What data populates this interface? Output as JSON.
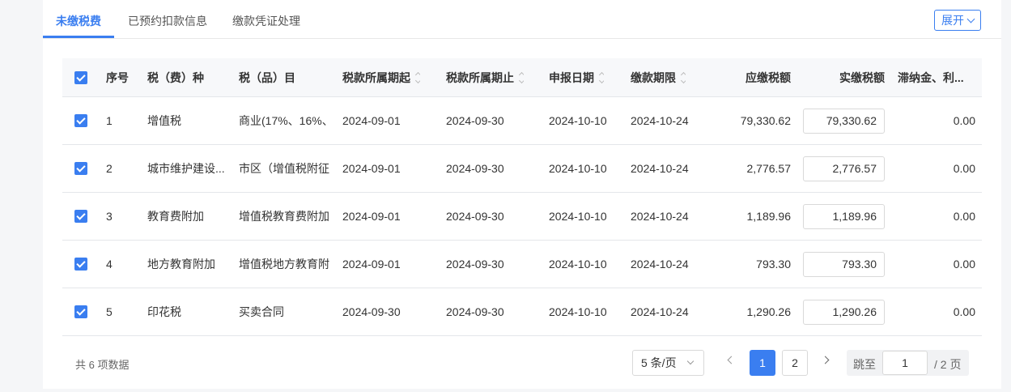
{
  "tabs": [
    {
      "label": "未缴税费",
      "active": true
    },
    {
      "label": "已预约扣款信息",
      "active": false
    },
    {
      "label": "缴款凭证处理",
      "active": false
    }
  ],
  "expand_label": "展开",
  "columns": {
    "index": "序号",
    "tax_type": "税（费）种",
    "tax_item": "税（品）目",
    "period_start": "税款所属期起",
    "period_end": "税款所属期止",
    "report_date": "申报日期",
    "deadline": "缴款期限",
    "payable": "应缴税额",
    "paid": "实缴税额",
    "late_fee": "滞纳金、利..."
  },
  "rows": [
    {
      "index": "1",
      "tax_type": "增值税",
      "tax_item": "商业(17%、16%、",
      "period_start": "2024-09-01",
      "period_end": "2024-09-30",
      "report_date": "2024-10-10",
      "deadline": "2024-10-24",
      "payable": "79,330.62",
      "paid": "79,330.62",
      "late_fee": "0.00",
      "checked": true
    },
    {
      "index": "2",
      "tax_type": "城市维护建设...",
      "tax_item": "市区（增值税附征",
      "period_start": "2024-09-01",
      "period_end": "2024-09-30",
      "report_date": "2024-10-10",
      "deadline": "2024-10-24",
      "payable": "2,776.57",
      "paid": "2,776.57",
      "late_fee": "0.00",
      "checked": true
    },
    {
      "index": "3",
      "tax_type": "教育费附加",
      "tax_item": "增值税教育费附加",
      "period_start": "2024-09-01",
      "period_end": "2024-09-30",
      "report_date": "2024-10-10",
      "deadline": "2024-10-24",
      "payable": "1,189.96",
      "paid": "1,189.96",
      "late_fee": "0.00",
      "checked": true
    },
    {
      "index": "4",
      "tax_type": "地方教育附加",
      "tax_item": "增值税地方教育附",
      "period_start": "2024-09-01",
      "period_end": "2024-09-30",
      "report_date": "2024-10-10",
      "deadline": "2024-10-24",
      "payable": "793.30",
      "paid": "793.30",
      "late_fee": "0.00",
      "checked": true
    },
    {
      "index": "5",
      "tax_type": "印花税",
      "tax_item": "买卖合同",
      "period_start": "2024-09-30",
      "period_end": "2024-09-30",
      "report_date": "2024-10-10",
      "deadline": "2024-10-24",
      "payable": "1,290.26",
      "paid": "1,290.26",
      "late_fee": "0.00",
      "checked": true
    }
  ],
  "footer": {
    "total_text": "共 6 项数据",
    "page_size": "5 条/页",
    "pages": [
      "1",
      "2"
    ],
    "current_page": "1",
    "jump_label": "跳至",
    "jump_value": "1",
    "total_pages_label": "/ 2 页"
  },
  "colors": {
    "accent": "#3a7ef0",
    "header_bg": "#f7f8fa",
    "border": "#e4e6ea"
  }
}
